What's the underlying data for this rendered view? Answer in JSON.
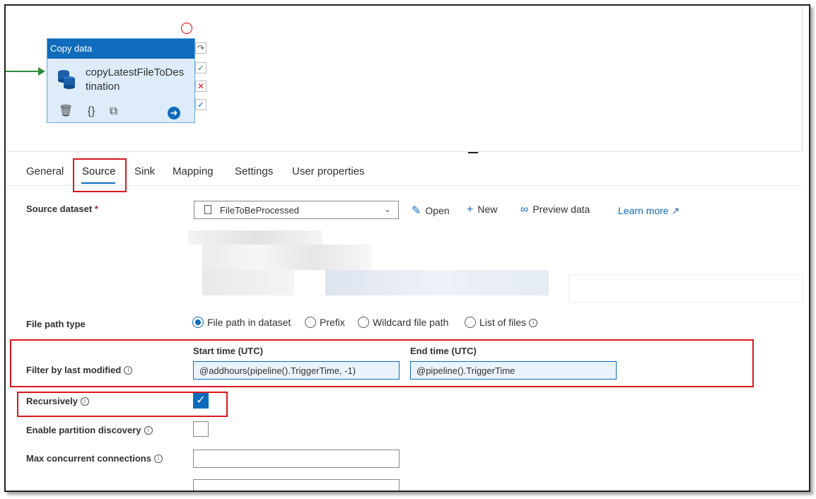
{
  "activity": {
    "type_label": "Copy data",
    "name": "copyLatestFileToDestination",
    "tools": [
      "delete-icon",
      "code-icon",
      "copy-icon"
    ]
  },
  "tabs": [
    {
      "label": "General"
    },
    {
      "label": "Source"
    },
    {
      "label": "Sink"
    },
    {
      "label": "Mapping"
    },
    {
      "label": "Settings"
    },
    {
      "label": "User properties"
    }
  ],
  "active_tab": "Source",
  "source": {
    "dataset_label": "Source dataset",
    "required_mark": "*",
    "dataset_value": "FileToBeProcessed",
    "open_label": "Open",
    "new_label": "New",
    "preview_label": "Preview data",
    "learn_more_label": "Learn more"
  },
  "file_path_type": {
    "label": "File path type",
    "options": [
      "File path in dataset",
      "Prefix",
      "Wildcard file path",
      "List of files"
    ],
    "selected": "File path in dataset"
  },
  "filter": {
    "label": "Filter by last modified",
    "start_header": "Start time (UTC)",
    "end_header": "End time (UTC)",
    "start_value": "@addhours(pipeline().TriggerTime, -1)",
    "end_value": "@pipeline().TriggerTime"
  },
  "recursively": {
    "label": "Recursively",
    "checked": true
  },
  "partition": {
    "label": "Enable partition discovery",
    "checked": false
  },
  "max_conn": {
    "label": "Max concurrent connections",
    "value": ""
  },
  "colors": {
    "accent": "#0f6cbd",
    "highlight": "#d9191e",
    "success": "#2e8b3a"
  }
}
